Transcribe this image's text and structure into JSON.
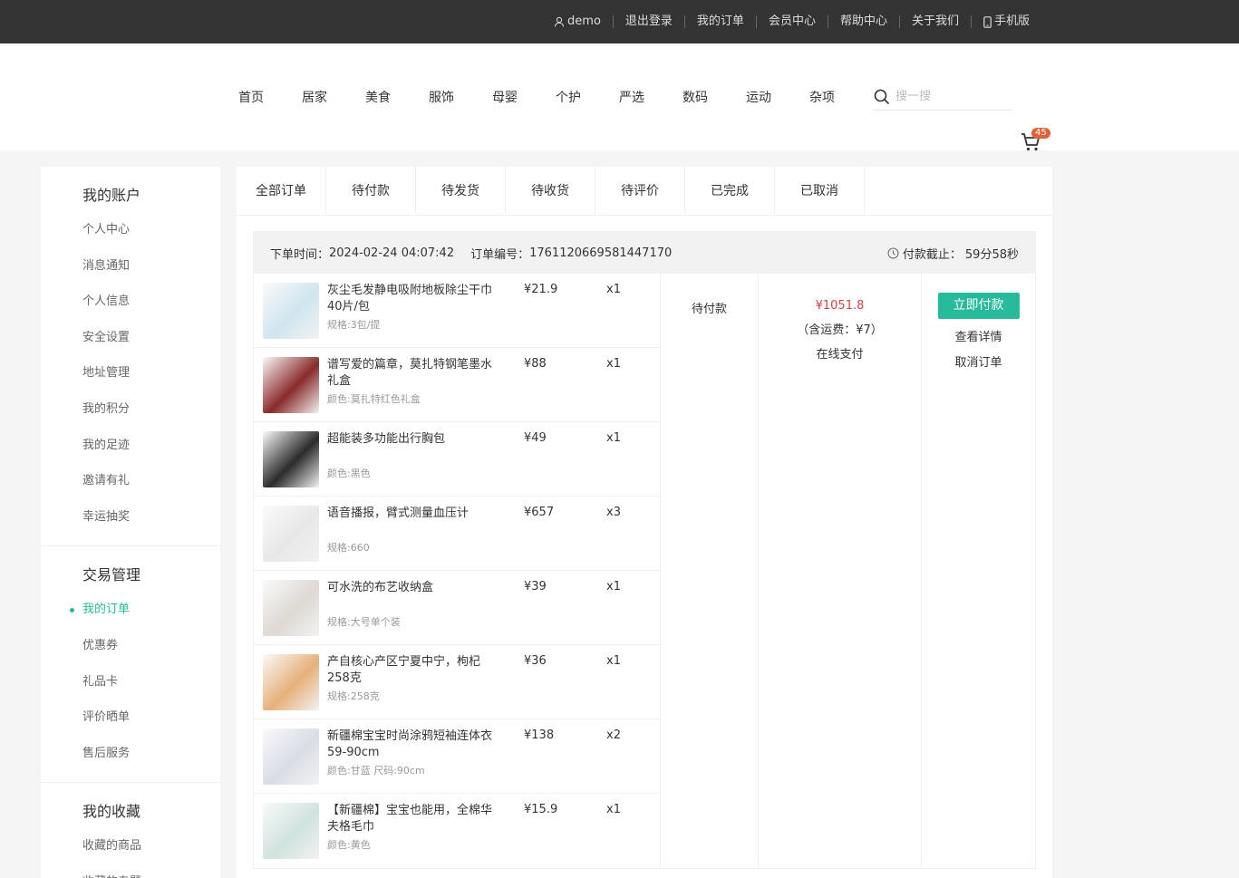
{
  "topbar": {
    "user": "demo",
    "logout": "退出登录",
    "my_orders": "我的订单",
    "member_center": "会员中心",
    "help_center": "帮助中心",
    "about": "关于我们",
    "mobile": "手机版"
  },
  "nav": [
    "首页",
    "居家",
    "美食",
    "服饰",
    "母婴",
    "个护",
    "严选",
    "数码",
    "运动",
    "杂项"
  ],
  "search": {
    "placeholder": "搜一搜"
  },
  "cart": {
    "count": "45"
  },
  "sidebar": {
    "groups": [
      {
        "title": "我的账户",
        "items": [
          "个人中心",
          "消息通知",
          "个人信息",
          "安全设置",
          "地址管理",
          "我的积分",
          "我的足迹",
          "邀请有礼",
          "幸运抽奖"
        ]
      },
      {
        "title": "交易管理",
        "items": [
          "我的订单",
          "优惠券",
          "礼品卡",
          "评价晒单",
          "售后服务"
        ]
      },
      {
        "title": "我的收藏",
        "items": [
          "收藏的商品",
          "收藏的专题"
        ]
      }
    ]
  },
  "tabs": [
    "全部订单",
    "待付款",
    "待发货",
    "待收货",
    "待评价",
    "已完成",
    "已取消"
  ],
  "order": {
    "time_label": "下单时间：",
    "time": "2024-02-24 04:07:42",
    "no_label": "订单编号：",
    "no": "1761120669581447170",
    "deadline_label": "付款截止：",
    "deadline": "59分58秒",
    "status": "待付款",
    "amount": "¥1051.8",
    "freight": "（含运费：¥7）",
    "pay_type": "在线支付",
    "pay_now": "立即付款",
    "view_detail": "查看详情",
    "cancel": "取消订单",
    "goods": [
      {
        "name": "灰尘毛发静电吸附地板除尘干巾40片/包",
        "attr": "规格:3包/提",
        "price": "¥21.9",
        "qty": "x1",
        "color": "#cfe6ef"
      },
      {
        "name": "谱写爱的篇章，莫扎特钢笔墨水礼盒",
        "attr": "颜色:莫扎特红色礼盒",
        "price": "¥88",
        "qty": "x1",
        "color": "#8a2a2a"
      },
      {
        "name": "超能装多功能出行胸包",
        "attr": "颜色:黑色",
        "price": "¥49",
        "qty": "x1",
        "color": "#2b2b2b"
      },
      {
        "name": "语音播报，臂式测量血压计",
        "attr": "规格:660",
        "price": "¥657",
        "qty": "x3",
        "color": "#e8e8e8"
      },
      {
        "name": "可水洗的布艺收纳盒",
        "attr": "规格:大号单个装",
        "price": "¥39",
        "qty": "x1",
        "color": "#ddd9d3"
      },
      {
        "name": "产自核心产区宁夏中宁，枸杞258克",
        "attr": "规格:258克",
        "price": "¥36",
        "qty": "x1",
        "color": "#e7b07a"
      },
      {
        "name": "新疆棉宝宝时尚涂鸦短袖连体衣59-90cm",
        "attr": "颜色:甘蓝 尺码:90cm",
        "price": "¥138",
        "qty": "x2",
        "color": "#d9dce6"
      },
      {
        "name": "【新疆棉】宝宝也能用，全棉华夫格毛巾",
        "attr": "颜色:黄色",
        "price": "¥15.9",
        "qty": "x1",
        "color": "#cfe3df"
      }
    ]
  }
}
